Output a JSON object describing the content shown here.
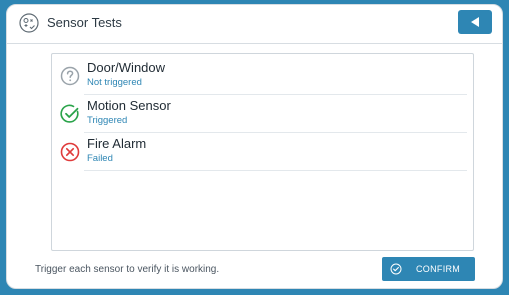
{
  "header": {
    "title": "Sensor Tests",
    "app_icon": "sensor-tests-icon",
    "back_icon": "back-arrow-icon"
  },
  "sensors": [
    {
      "name": "Door/Window",
      "status": "Not triggered",
      "icon": "question-circle-icon",
      "icon_color": "#9aa3aa"
    },
    {
      "name": "Motion Sensor",
      "status": "Triggered",
      "icon": "check-circle-icon",
      "icon_color": "#2aa34a"
    },
    {
      "name": "Fire Alarm",
      "status": "Failed",
      "icon": "error-circle-icon",
      "icon_color": "#e03b3b"
    }
  ],
  "footer": {
    "instruction": "Trigger each sensor to verify it is working.",
    "confirm_label": "CONFIRM",
    "confirm_icon": "check-circle-icon"
  },
  "colors": {
    "accent": "#2e86b4",
    "status_text": "#2e86b4"
  }
}
